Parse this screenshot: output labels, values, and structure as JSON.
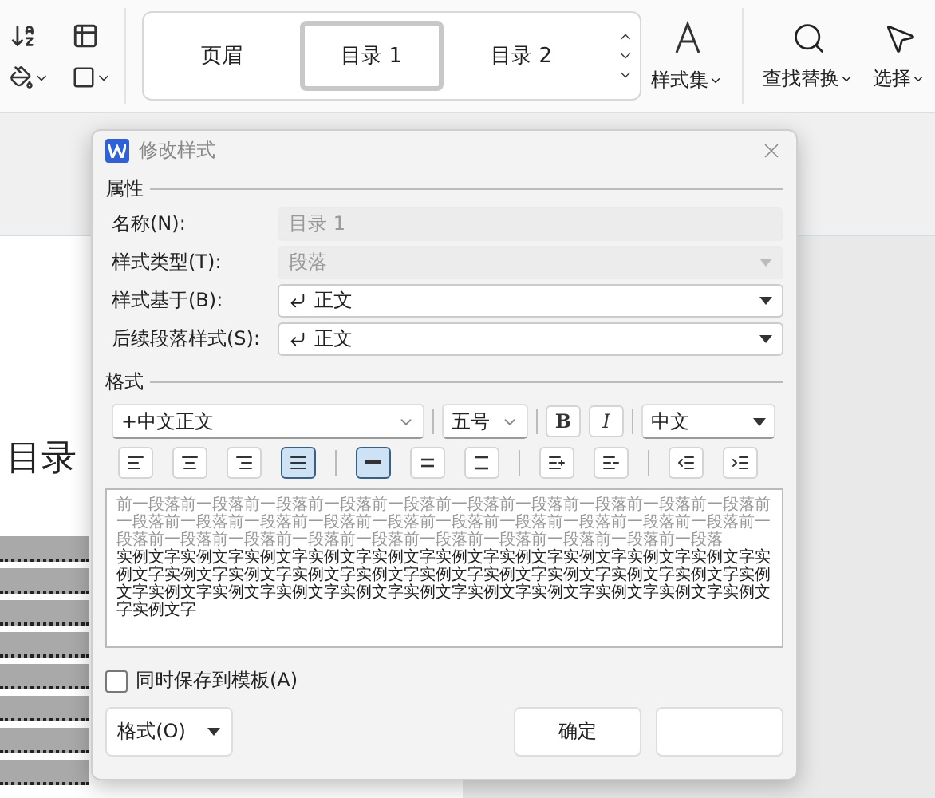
{
  "ribbon": {
    "styles": [
      {
        "label": "页眉",
        "selected": false
      },
      {
        "label": "目录 1",
        "selected": true
      },
      {
        "label": "目录 2",
        "selected": false
      }
    ],
    "style_set": "样式集",
    "find_replace": "查找替换",
    "select": "选择"
  },
  "document": {
    "heading": "目录"
  },
  "dialog": {
    "title": "修改样式",
    "properties": {
      "heading": "属性",
      "fields": [
        {
          "label": "名称(N):",
          "value": "目录 1",
          "kind": "text",
          "disabled": true
        },
        {
          "label": "样式类型(T):",
          "value": "段落",
          "kind": "select",
          "disabled": true
        },
        {
          "label": "样式基于(B):",
          "value": "正文",
          "kind": "style",
          "disabled": false
        },
        {
          "label": "后续段落样式(S):",
          "value": "正文",
          "kind": "style",
          "disabled": false
        }
      ]
    },
    "format": {
      "heading": "格式",
      "font": "+中文正文",
      "size": "五号",
      "bold": {
        "label": "B",
        "selected": false
      },
      "italic": {
        "label": "I",
        "selected": false
      },
      "script": "中文",
      "alignment": [
        {
          "kind": "left",
          "selected": false
        },
        {
          "kind": "center",
          "selected": false
        },
        {
          "kind": "right",
          "selected": false
        },
        {
          "kind": "justify",
          "selected": true
        }
      ],
      "line_spacing": [
        {
          "kind": "single",
          "selected": true
        },
        {
          "kind": "one-half",
          "selected": false
        },
        {
          "kind": "double",
          "selected": false
        }
      ],
      "paragraph_spacing": [
        {
          "kind": "before"
        },
        {
          "kind": "after"
        }
      ],
      "indent": [
        {
          "kind": "decrease"
        },
        {
          "kind": "increase"
        }
      ]
    },
    "preview": {
      "previous": "前一段落前一段落前一段落前一段落前一段落前一段落前一段落前一段落前一段落前一段落前一段落前一段落前一段落前一段落前一段落前一段落前一段落前一段落前一段落前一段落前一段落前一段落前一段落前一段落前一段落前一段落前一段落前一段落前一段落前一段落",
      "sample": "实例文字实例文字实例文字实例文字实例文字实例文字实例文字实例文字实例文字实例文字实例文字实例文字实例文字实例文字实例文字实例文字实例文字实例文字实例文字实例文字实例文字实例文字实例文字实例文字实例文字实例文字实例文字实例文字实例文字实例文字实例文字实例文字"
    },
    "save_to_template": {
      "label": "同时保存到模板(A)",
      "checked": false
    },
    "buttons": {
      "format": "格式(O)",
      "ok": "确定"
    }
  }
}
